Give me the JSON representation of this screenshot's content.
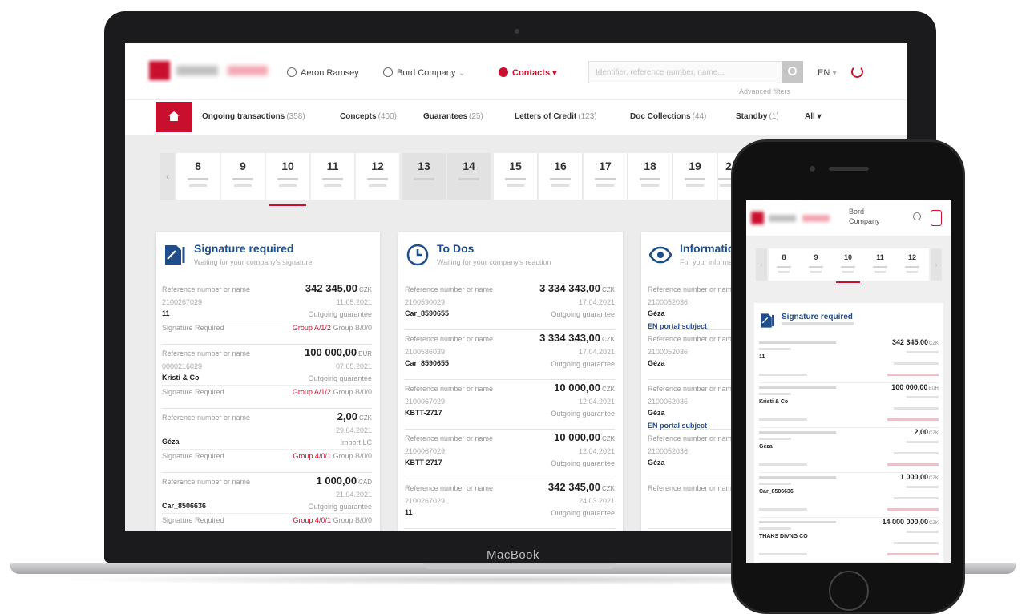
{
  "laptop": {
    "brand": "MacBook",
    "header": {
      "user": "Aeron Ramsey",
      "company": "Bord Company",
      "contacts": "Contacts",
      "search_placeholder": "Identifier, reference number, name...",
      "advanced_filters": "Advanced filters",
      "language": "EN"
    },
    "nav": {
      "tabs": [
        {
          "label": "Ongoing transactions",
          "count": "(358)"
        },
        {
          "label": "Concepts",
          "count": "(400)"
        },
        {
          "label": "Guarantees",
          "count": "(25)"
        },
        {
          "label": "Letters of Credit",
          "count": "(123)"
        },
        {
          "label": "Doc Collections",
          "count": "(44)"
        },
        {
          "label": "Standby",
          "count": "(1)"
        },
        {
          "label": "All",
          "count": ""
        }
      ]
    },
    "calendar": {
      "prev": "‹",
      "days": [
        "8",
        "9",
        "10",
        "11",
        "12",
        "13",
        "14",
        "15",
        "16",
        "17",
        "18",
        "19",
        "2"
      ],
      "selected_index": 2,
      "weekend_indices": [
        5,
        6
      ]
    },
    "cards": [
      {
        "title": "Signature required",
        "subtitle": "Waiting for your company's signature",
        "rows": [
          {
            "label": "Reference number or name",
            "amount": "342 345,00",
            "currency": "CZK",
            "ref": "2100267029",
            "date": "11.05.2021",
            "name": "11",
            "type": "Outgoing guarantee",
            "sig": "Signature Required",
            "group_red": "Group A/1/2",
            "group": "Group B/0/0"
          },
          {
            "label": "Reference number or name",
            "amount": "100 000,00",
            "currency": "EUR",
            "ref": "0000216029",
            "date": "07.05.2021",
            "name": "Kristi & Co",
            "type": "Outgoing guarantee",
            "sig": "Signature Required",
            "group_red": "Group A/1/2",
            "group": "Group B/0/0"
          },
          {
            "label": "Reference number or name",
            "amount": "2,00",
            "currency": "CZK",
            "ref": "",
            "date": "29.04.2021",
            "name": "Géza",
            "type": "Import LC",
            "sig": "Signature Required",
            "group_red": "Group 4/0/1",
            "group": "Group B/0/0"
          },
          {
            "label": "Reference number or name",
            "amount": "1 000,00",
            "currency": "CAD",
            "ref": "",
            "date": "21.04.2021",
            "name": "Car_8506636",
            "type": "Outgoing guarantee",
            "sig": "Signature Required",
            "group_red": "Group 4/0/1",
            "group": "Group B/0/0"
          }
        ]
      },
      {
        "title": "To Dos",
        "subtitle": "Waiting for your company's reaction",
        "rows": [
          {
            "label": "Reference number or name",
            "amount": "3 334 343,00",
            "currency": "CZK",
            "ref": "2100590029",
            "date": "17.04.2021",
            "name": "Car_8590655",
            "type": "Outgoing guarantee"
          },
          {
            "label": "Reference number or name",
            "amount": "3 334 343,00",
            "currency": "CZK",
            "ref": "2100586039",
            "date": "17.04.2021",
            "name": "Car_8590655",
            "type": "Outgoing guarantee"
          },
          {
            "label": "Reference number or name",
            "amount": "10 000,00",
            "currency": "CZK",
            "ref": "2100067029",
            "date": "12.04.2021",
            "name": "KBTT-2717",
            "type": "Outgoing guarantee"
          },
          {
            "label": "Reference number or name",
            "amount": "10 000,00",
            "currency": "CZK",
            "ref": "2100067029",
            "date": "12.04.2021",
            "name": "KBTT-2717",
            "type": "Outgoing guarantee"
          },
          {
            "label": "Reference number or name",
            "amount": "342 345,00",
            "currency": "CZK",
            "ref": "2100267029",
            "date": "24.03.2021",
            "name": "11",
            "type": "Outgoing guarantee"
          }
        ]
      },
      {
        "title": "Information",
        "subtitle": "For your information",
        "rows": [
          {
            "label": "Reference number or name",
            "ref": "2100052036",
            "name": "Géza",
            "link": "EN portal subject"
          },
          {
            "label": "Reference number or name",
            "ref": "2100052036",
            "name": "Géza"
          },
          {
            "label": "Reference number or name",
            "ref": "2100052036",
            "name": "Géza",
            "link": "EN portal subject"
          },
          {
            "label": "Reference number or name",
            "ref": "2100052036",
            "name": "Géza"
          },
          {
            "label": "Reference number or name",
            "ref": "",
            "name": ""
          }
        ]
      }
    ]
  },
  "phone": {
    "company": "Bord Company",
    "days": [
      "8",
      "9",
      "10",
      "11",
      "12"
    ],
    "selected_index": 2,
    "card": {
      "title": "Signature required",
      "rows": [
        {
          "amount": "342 345,00",
          "currency": "CZK",
          "name": "11"
        },
        {
          "amount": "100 000,00",
          "currency": "EUR",
          "name": "Kristi & Co"
        },
        {
          "amount": "2,00",
          "currency": "CZK",
          "name": "Géza"
        },
        {
          "amount": "1 000,00",
          "currency": "CZK",
          "name": "Car_8506636"
        },
        {
          "amount": "14 000 000,00",
          "currency": "CZK",
          "name": "THAKS DIVNG CO"
        }
      ]
    }
  },
  "colors": {
    "brand_red": "#c8102e",
    "title_blue": "#1f4e8c"
  }
}
